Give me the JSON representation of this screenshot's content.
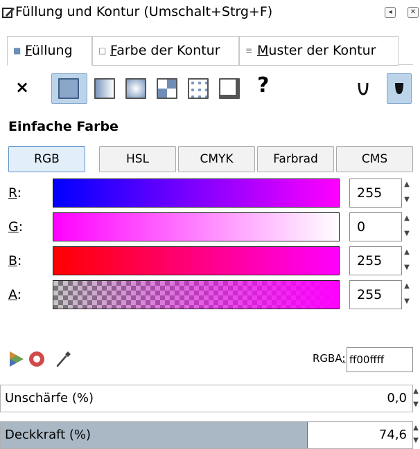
{
  "window": {
    "title": "Füllung und Kontur (Umschalt+Strg+F)",
    "collapse_icon": "◂",
    "close_icon": "✕"
  },
  "tabs": [
    {
      "prefix": "",
      "mnemonic": "F",
      "rest": "üllung",
      "icon": "fill-swatch-icon",
      "active": true
    },
    {
      "prefix": "",
      "mnemonic": "F",
      "rest": "arbe der Kontur",
      "icon": "stroke-swatch-icon",
      "active": false
    },
    {
      "prefix": "",
      "mnemonic": "M",
      "rest": "uster der Kontur",
      "icon": "stroke-style-icon",
      "active": false
    }
  ],
  "fill_types": {
    "none_symbol": "×",
    "unknown_symbol": "?",
    "selected": "flat",
    "icons": [
      "no-paint-icon",
      "flat-color-icon",
      "linear-gradient-icon",
      "radial-gradient-icon",
      "mesh-gradient-icon",
      "pattern-icon",
      "swatch-icon",
      "unknown-paint-icon"
    ],
    "fill_rule_icons": [
      "evenodd-icon",
      "nonzero-icon"
    ]
  },
  "section_title": "Einfache Farbe",
  "color_modes": [
    "RGB",
    "HSL",
    "CMYK",
    "Farbrad",
    "CMS"
  ],
  "active_mode": "RGB",
  "channels": [
    {
      "mnemonic": "R",
      "suffix": ":",
      "value": "255"
    },
    {
      "mnemonic": "G",
      "suffix": ":",
      "value": "0"
    },
    {
      "mnemonic": "B",
      "suffix": ":",
      "value": "255"
    },
    {
      "mnemonic": "A",
      "suffix": ":",
      "value": "255"
    }
  ],
  "rgba": {
    "label_prefix": "RGBA",
    "label_suffix": ":",
    "mnemonic": "",
    "value": "ff00ffff"
  },
  "blur": {
    "label": "Unschärfe (%)",
    "value": "0,0"
  },
  "opacity": {
    "label": "Deckkraft (%)",
    "value": "74,6",
    "fraction": 0.746
  },
  "colors": {
    "current": "#ff00ff",
    "selected_bg": "#bcd4ea",
    "opacity_fill": "#a9b8c4"
  }
}
